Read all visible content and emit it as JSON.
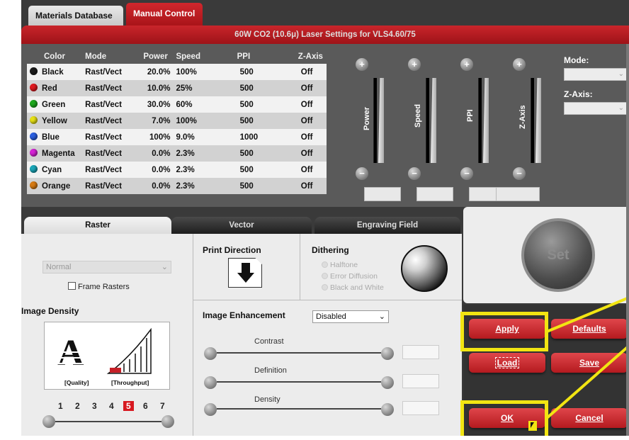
{
  "tabs": {
    "materials": "Materials Database",
    "manual": "Manual Control"
  },
  "header": {
    "title": "60W CO2 (10.6μ) Laser Settings for VLS4.60/75"
  },
  "table": {
    "headers": [
      "Color",
      "Mode",
      "Power",
      "Speed",
      "PPI",
      "Z-Axis"
    ],
    "rows": [
      {
        "color": "Black",
        "dot": "#1c1c1c",
        "mode": "Rast/Vect",
        "power": "20.0%",
        "speed": "100%",
        "ppi": "500",
        "z": "Off"
      },
      {
        "color": "Red",
        "dot": "#e0191f",
        "mode": "Rast/Vect",
        "power": "10.0%",
        "speed": "25%",
        "ppi": "500",
        "z": "Off"
      },
      {
        "color": "Green",
        "dot": "#1da81d",
        "mode": "Rast/Vect",
        "power": "30.0%",
        "speed": "60%",
        "ppi": "500",
        "z": "Off"
      },
      {
        "color": "Yellow",
        "dot": "#e6e015",
        "mode": "Rast/Vect",
        "power": "7.0%",
        "speed": "100%",
        "ppi": "500",
        "z": "Off"
      },
      {
        "color": "Blue",
        "dot": "#2b5fe0",
        "mode": "Rast/Vect",
        "power": "100%",
        "speed": "9.0%",
        "ppi": "1000",
        "z": "Off"
      },
      {
        "color": "Magenta",
        "dot": "#d623d6",
        "mode": "Rast/Vect",
        "power": "0.0%",
        "speed": "2.3%",
        "ppi": "500",
        "z": "Off"
      },
      {
        "color": "Cyan",
        "dot": "#1aa6b8",
        "mode": "Rast/Vect",
        "power": "0.0%",
        "speed": "2.3%",
        "ppi": "500",
        "z": "Off"
      },
      {
        "color": "Orange",
        "dot": "#d67a12",
        "mode": "Rast/Vect",
        "power": "0.0%",
        "speed": "2.3%",
        "ppi": "500",
        "z": "Off"
      }
    ]
  },
  "sliders": {
    "power": "Power",
    "speed": "Speed",
    "ppi": "PPI",
    "zaxis": "Z-Axis"
  },
  "side": {
    "mode_label": "Mode:",
    "zaxis_label": "Z-Axis:"
  },
  "lower_tabs": {
    "raster": "Raster",
    "vector": "Vector",
    "field": "Engraving Field"
  },
  "raster": {
    "mode_select": "Normal",
    "frame_rasters": "Frame Rasters",
    "image_density": "Image Density",
    "quality": "[Quality]",
    "throughput": "[Throughput]",
    "density_levels": [
      "1",
      "2",
      "3",
      "4",
      "5",
      "6",
      "7"
    ],
    "density_selected": 5,
    "print_direction": "Print Direction",
    "dithering": "Dithering",
    "dither_options": [
      "Halftone",
      "Error Diffusion",
      "Black and White"
    ],
    "image_enhancement": "Image Enhancement",
    "enhancement_value": "Disabled",
    "contrast": "Contrast",
    "definition": "Definition",
    "density": "Density"
  },
  "set_label": "Set",
  "buttons": {
    "apply": "Apply",
    "defaults": "Defaults",
    "load": "Load",
    "save": "Save",
    "ok": "OK",
    "cancel": "Cancel"
  },
  "colors": {
    "accent_red": "#b41a1f",
    "highlight": "#f2e512"
  }
}
